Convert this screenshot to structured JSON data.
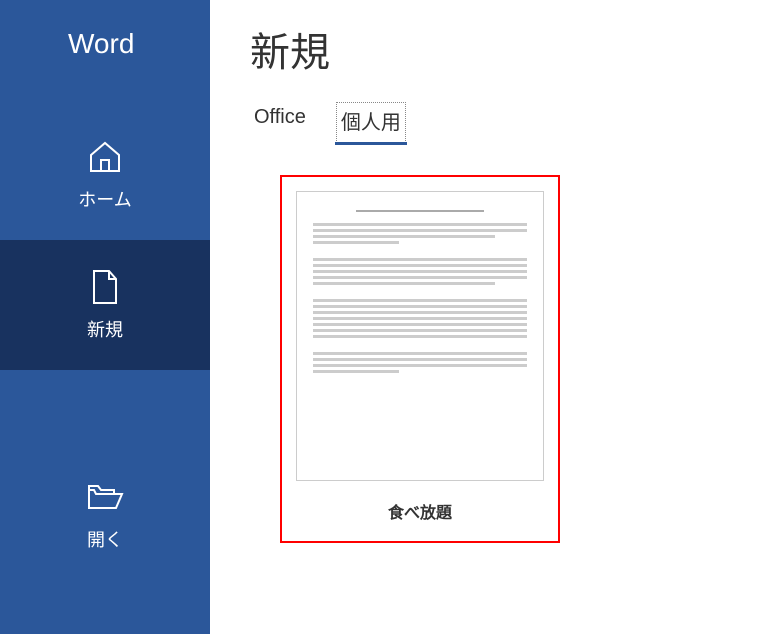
{
  "app_title": "Word",
  "sidebar": {
    "items": [
      {
        "label": "ホーム",
        "icon": "home-icon"
      },
      {
        "label": "新規",
        "icon": "document-icon"
      },
      {
        "label": "開く",
        "icon": "folder-open-icon"
      }
    ],
    "active_index": 1
  },
  "main": {
    "page_title": "新規",
    "tabs": [
      {
        "label": "Office"
      },
      {
        "label": "個人用"
      }
    ],
    "active_tab_index": 1,
    "templates": [
      {
        "label": "食べ放題",
        "highlighted": true
      }
    ]
  }
}
